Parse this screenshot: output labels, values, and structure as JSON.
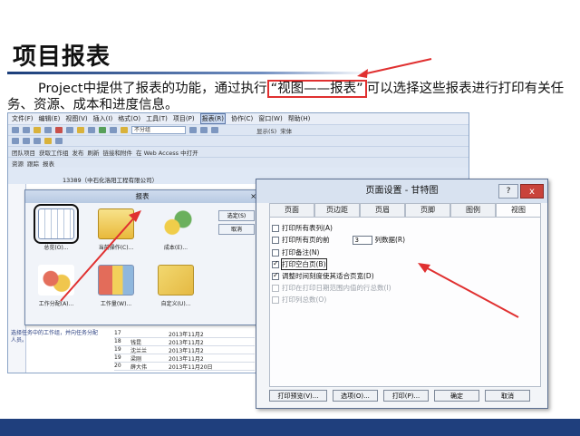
{
  "slide": {
    "title": "项目报表",
    "para_before": "Project中提供了报表的功能，通过执行",
    "para_highlight": "“视图——报表”",
    "para_after": "可以选择这些报表进行打印有关任务、资源、成本和进度信息。",
    "accent_color": "#e03030",
    "footer_color": "#1f3f7d"
  },
  "project_window": {
    "menu_items": [
      "文件(F)",
      "编辑(E)",
      "视图(V)",
      "插入(I)",
      "格式(O)",
      "工具(T)",
      "项目(P)",
      "报表(R)",
      "协作(C)",
      "窗口(W)",
      "帮助(H)"
    ],
    "toolbar_combo": "不分组",
    "toolbar_show": "显示(S)",
    "toolbar_font": "宋体",
    "toolbar2_items": [
      "团队项目",
      "获取工作组",
      "发布",
      "刷新",
      "链接和附件",
      "在 Web Access 中打开"
    ],
    "toolbar3_items": [
      "资源",
      "跟踪",
      "报表"
    ],
    "project_name": "13389（中石化洛阳工程有限公司）",
    "left_note": "选择任务中的工作组，并向任务分配人员。"
  },
  "report_dialog": {
    "title": "报表",
    "close": "×",
    "items": [
      {
        "label": "总览(O)..."
      },
      {
        "label": "当前操作(C)..."
      },
      {
        "label": "成本(E)..."
      },
      {
        "label": "工作分配(A)..."
      },
      {
        "label": "工作量(W)..."
      },
      {
        "label": "自定义(U)..."
      }
    ],
    "side_buttons": [
      "选定(S)",
      "取消"
    ]
  },
  "gantt_rows": [
    {
      "id": "17",
      "name": "",
      "date": "2013年11月2"
    },
    {
      "id": "18",
      "name": "钱昆",
      "date": "2013年11月2"
    },
    {
      "id": "19",
      "name": "沈兰兰",
      "date": "2013年11月2"
    },
    {
      "id": "19",
      "name": "梁刚",
      "date": "2013年11月2"
    },
    {
      "id": "20",
      "name": "薛大伟",
      "date": "2013年11月20日"
    }
  ],
  "page_setup": {
    "title": "页面设置 - 甘特图",
    "help": "?",
    "close": "x",
    "tabs": [
      "页面",
      "页边距",
      "页眉",
      "页脚",
      "图例",
      "视图"
    ],
    "active_tab": 5,
    "options": {
      "print_all_columns": "打印所有表列(A)",
      "print_first_pages": "打印所有页的前",
      "first_pages_value": "3",
      "columns_unit": "列数据(R)",
      "print_notes": "打印备注(N)",
      "print_blank": "打印空白页(B)",
      "adjust_timescale": "调整时间刻度使其适合页宽(D)",
      "print_range_totals": "打印在打印日期范围内值的行总数(I)",
      "print_column_totals": "打印列总数(O)"
    },
    "buttons": {
      "preview": "打印预览(V)...",
      "options": "选项(O)...",
      "print": "打印(P)...",
      "ok": "确定",
      "cancel": "取消"
    }
  }
}
